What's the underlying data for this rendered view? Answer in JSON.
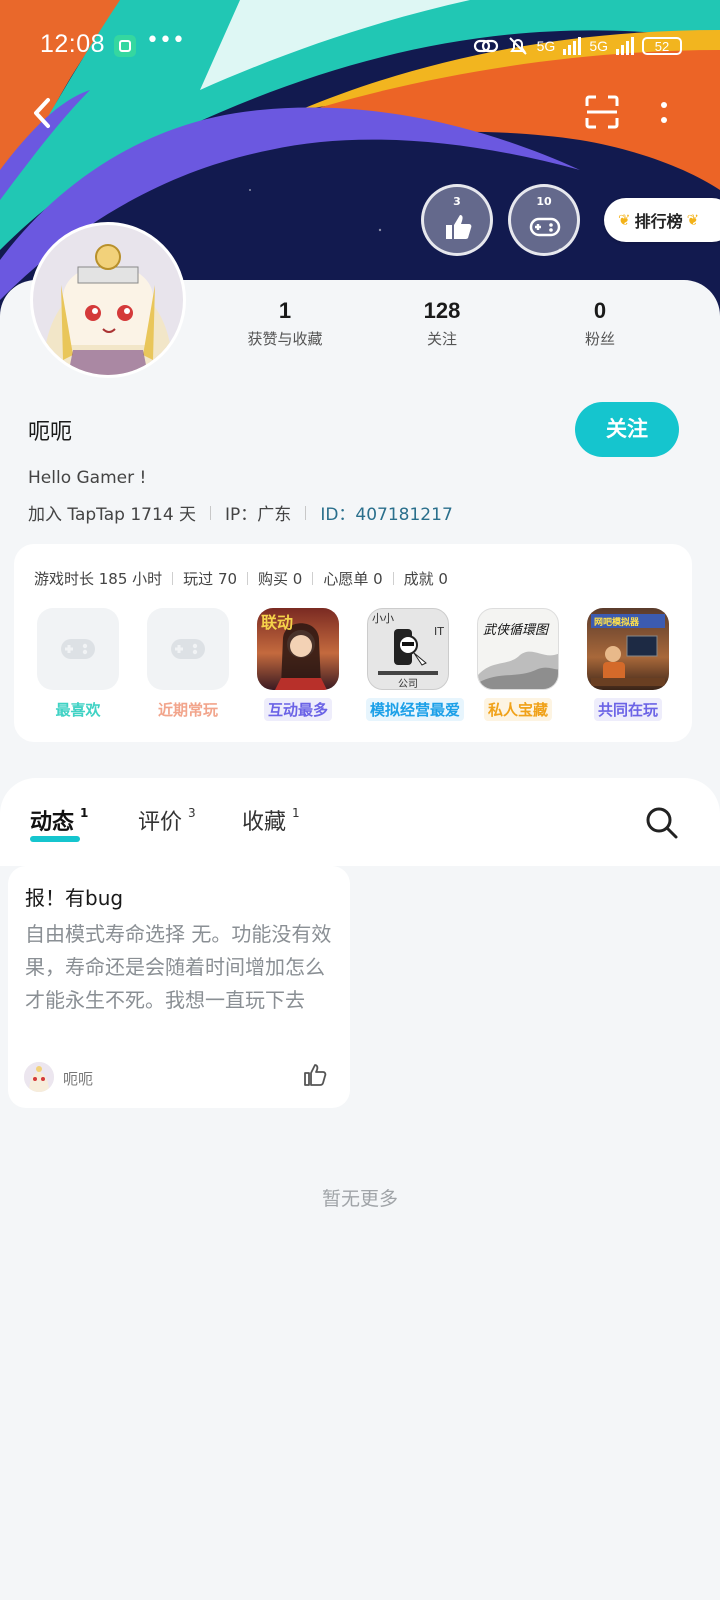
{
  "status_bar": {
    "time": "12:08",
    "dots": "•••",
    "network1": "5G",
    "network2": "5G",
    "battery": "52"
  },
  "header": {
    "back_icon": "chevron-left-icon",
    "scan_icon": "scan-icon",
    "more_icon": "more-vertical-icon",
    "medals": [
      {
        "count": "3",
        "icon": "thumbs-up-icon"
      },
      {
        "count": "10",
        "icon": "gamepad-icon"
      }
    ],
    "rank_label": "排行榜"
  },
  "profile": {
    "stats": [
      {
        "value": "1",
        "label": "获赞与收藏"
      },
      {
        "value": "128",
        "label": "关注"
      },
      {
        "value": "0",
        "label": "粉丝"
      }
    ],
    "username": "呃呃",
    "follow_label": "关注",
    "bio": "Hello Gamer !",
    "join_text": "加入 TapTap 1714 天",
    "ip_text": "IP：广东",
    "id_text": "ID：407181217"
  },
  "games": {
    "stats": [
      "游戏时长 185 小时",
      "玩过 70",
      "购买 0",
      "心愿单 0",
      "成就 0"
    ],
    "tiles": [
      {
        "label": "最喜欢",
        "color": "#3fd2c4"
      },
      {
        "label": "近期常玩",
        "color": "#f2a58c"
      },
      {
        "label": "互动最多",
        "color": "#6b63e6"
      },
      {
        "label": "模拟经营最爱",
        "color": "#1ca0e8"
      },
      {
        "label": "私人宝藏",
        "color": "#f0a21a"
      },
      {
        "label": "共同在玩",
        "color": "#6b63e6"
      }
    ],
    "tile_texts": {
      "game1": "联动",
      "game2_top": "小小",
      "game2_it": "IT",
      "game2_bottom": "公司",
      "game3": "武侠循環图",
      "game4": "网吧模拟器"
    }
  },
  "tabs": [
    {
      "label": "动态",
      "count": "1"
    },
    {
      "label": "评价",
      "count": "3"
    },
    {
      "label": "收藏",
      "count": "1"
    }
  ],
  "post": {
    "title": "报！有bug",
    "body": "自由模式寿命选择 无。功能没有效果，寿命还是会随着时间增加怎么才能永生不死。我想一直玩下去",
    "author": "呃呃"
  },
  "footer": {
    "no_more": "暂无更多"
  }
}
